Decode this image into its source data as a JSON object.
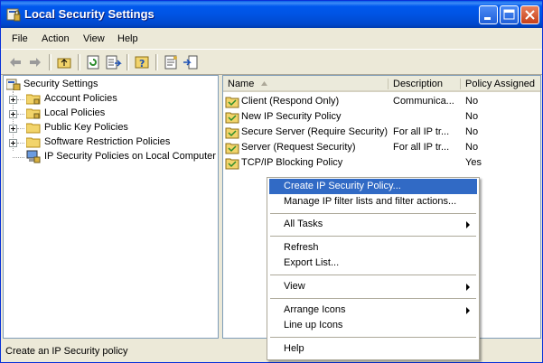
{
  "window": {
    "title": "Local Security Settings"
  },
  "menubar": [
    "File",
    "Action",
    "View",
    "Help"
  ],
  "toolbar": [
    "back-icon",
    "forward-icon",
    "up-folder-icon",
    "refresh-icon",
    "export-list-icon",
    "help-icon",
    "properties-icon",
    "import-icon"
  ],
  "tree": {
    "root": "Security Settings",
    "items": [
      {
        "label": "Account Policies",
        "expandable": true
      },
      {
        "label": "Local Policies",
        "expandable": true
      },
      {
        "label": "Public Key Policies",
        "expandable": true
      },
      {
        "label": "Software Restriction Policies",
        "expandable": true
      },
      {
        "label": "IP Security Policies on Local Computer",
        "expandable": false
      }
    ]
  },
  "list": {
    "columns": [
      "Name",
      "Description",
      "Policy Assigned"
    ],
    "rows": [
      {
        "name": "Client (Respond Only)",
        "description": "Communica...",
        "assigned": "No"
      },
      {
        "name": "New IP Security Policy",
        "description": "",
        "assigned": "No"
      },
      {
        "name": "Secure Server (Require Security)",
        "description": "For all IP tr...",
        "assigned": "No"
      },
      {
        "name": "Server (Request Security)",
        "description": "For all IP tr...",
        "assigned": "No"
      },
      {
        "name": "TCP/IP Blocking Policy",
        "description": "",
        "assigned": "Yes"
      }
    ]
  },
  "context_menu": {
    "items": [
      "Create IP Security Policy...",
      "Manage IP filter lists and filter actions...",
      "All Tasks",
      "Refresh",
      "Export List...",
      "View",
      "Arrange Icons",
      "Line up Icons",
      "Help"
    ],
    "selected": "Create IP Security Policy..."
  },
  "status": {
    "text": "Create an IP Security policy"
  },
  "colors": {
    "titlebar": "#0054E3",
    "selection": "#316AC5",
    "chrome": "#ECE9D8"
  }
}
